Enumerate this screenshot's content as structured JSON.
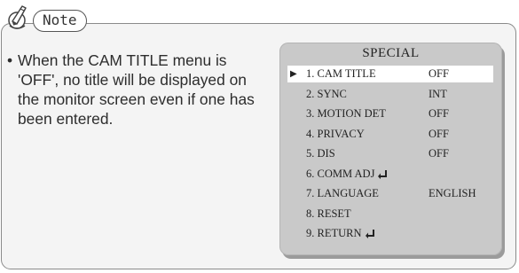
{
  "note": {
    "label": "Note",
    "bullet": "•",
    "text": "When the CAM TITLE menu is 'OFF', no title will be displayed on the monitor screen even if one has been entered."
  },
  "osd": {
    "title": "SPECIAL",
    "selected_marker": "▶",
    "items": [
      {
        "label": "1. CAM TITLE",
        "value": "OFF",
        "selected": true
      },
      {
        "label": "2. SYNC",
        "value": "INT"
      },
      {
        "label": "3. MOTION DET",
        "value": "OFF"
      },
      {
        "label": "4. PRIVACY",
        "value": "OFF"
      },
      {
        "label": "5. DIS",
        "value": "OFF"
      },
      {
        "label": "6. COMM ADJ",
        "value": "",
        "icon": "enter-icon"
      },
      {
        "label": "7. LANGUAGE",
        "value": "ENGLISH"
      },
      {
        "label": "8. RESET",
        "value": ""
      },
      {
        "label": "9. RETURN",
        "value": "",
        "icon": "enter-icon"
      }
    ]
  }
}
